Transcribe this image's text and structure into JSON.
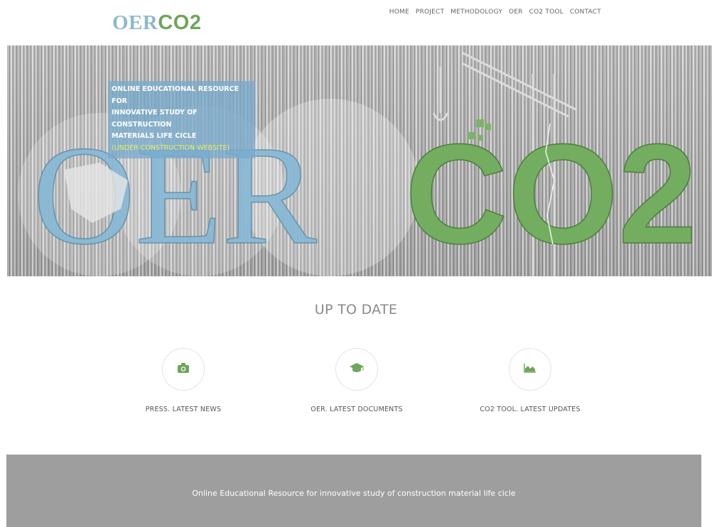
{
  "logo": {
    "part1": "OER",
    "part2": "CO2"
  },
  "nav": {
    "items": [
      "HOME",
      "PROJECT",
      "METHODOLOGY",
      "OER",
      "CO2 TOOL",
      "CONTACT"
    ]
  },
  "hero": {
    "tagline_lines": [
      "ONLINE EDUCATIONAL RESOURCE FOR",
      "INNOVATIVE STUDY OF CONSTRUCTION",
      "MATERIALS LIFE CICLE"
    ],
    "under_construction": "(UNDER CONSTRUCTION WEBSITE)",
    "big_word_part1": "OER",
    "big_word_part2": "CO2"
  },
  "section": {
    "title": "UP TO DATE",
    "features": [
      {
        "icon": "camera-icon",
        "label": "PRESS. LATEST NEWS"
      },
      {
        "icon": "graduation-cap-icon",
        "label": "OER. LATEST DOCUMENTS"
      },
      {
        "icon": "area-chart-icon",
        "label": "CO2 TOOL. LATEST UPDATES"
      }
    ]
  },
  "footer": {
    "text": "Online Educational Resource for innovative study of construction material life cicle"
  },
  "colors": {
    "oer_blue": "#8fb8cc",
    "co2_green": "#6ea55a",
    "footer_gray": "#9e9e9e",
    "tagline_yellow": "#e8ef5c"
  }
}
